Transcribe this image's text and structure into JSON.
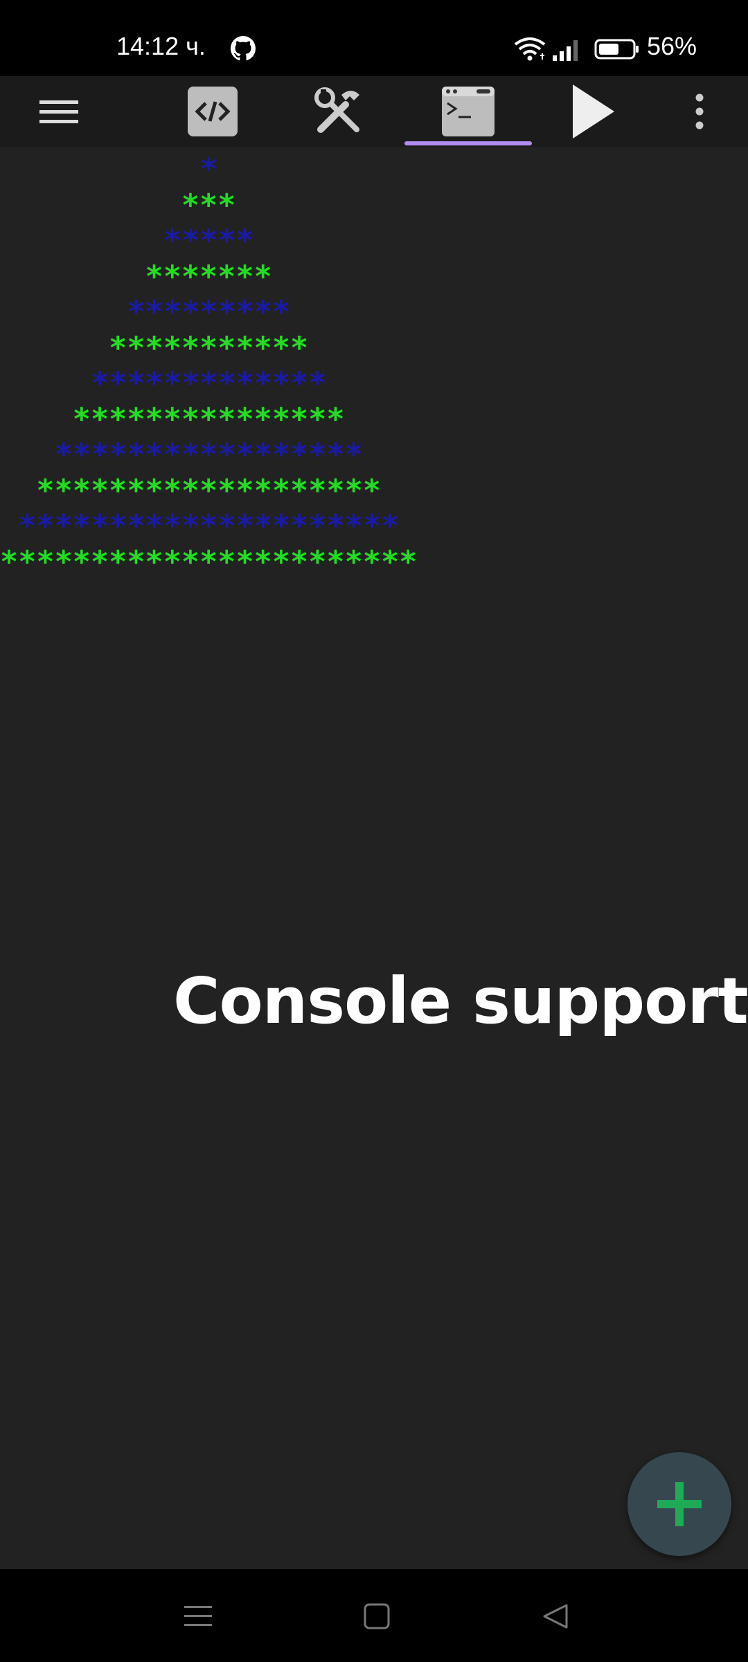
{
  "status_bar": {
    "time": "14:12 ч.",
    "battery": "56%"
  },
  "toolbar": {
    "icons": [
      "menu-icon",
      "code-icon",
      "tools-icon",
      "console-icon",
      "play-icon",
      "more-vert-icon"
    ],
    "active_tab": "console",
    "accent_color": "#b38cf0"
  },
  "console": {
    "colors": {
      "blue": "#1a1aa8",
      "green": "#22dd22"
    },
    "lines": [
      {
        "text": "           *",
        "color": "blue"
      },
      {
        "text": "          ***",
        "color": "green"
      },
      {
        "text": "         *****",
        "color": "blue"
      },
      {
        "text": "        *******",
        "color": "green"
      },
      {
        "text": "       *********",
        "color": "blue"
      },
      {
        "text": "      ***********",
        "color": "green"
      },
      {
        "text": "     *************",
        "color": "blue"
      },
      {
        "text": "    ***************",
        "color": "green"
      },
      {
        "text": "   *****************",
        "color": "blue"
      },
      {
        "text": "  *******************",
        "color": "green"
      },
      {
        "text": " *********************",
        "color": "blue"
      },
      {
        "text": "***********************",
        "color": "green"
      }
    ]
  },
  "promo": {
    "caption": "Console support"
  },
  "fab": {
    "icon": "plus-icon",
    "color": "#37474f",
    "icon_color": "#1faa55"
  }
}
